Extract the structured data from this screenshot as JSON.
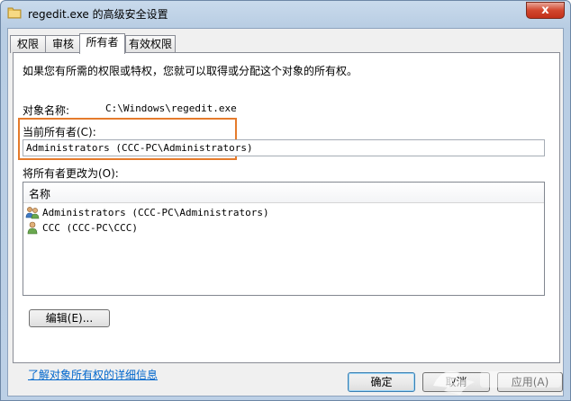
{
  "window": {
    "title": "regedit.exe 的高级安全设置",
    "close_glyph": "x"
  },
  "tabs": [
    {
      "label": "权限"
    },
    {
      "label": "审核"
    },
    {
      "label": "所有者"
    },
    {
      "label": "有效权限"
    }
  ],
  "active_tab": "所有者",
  "owner_page": {
    "intro": "如果您有所需的权限或特权，您就可以取得或分配这个对象的所有权。",
    "object_name_label": "对象名称:",
    "object_name_value": "C:\\Windows\\regedit.exe",
    "current_owner_label": "当前所有者(C):",
    "current_owner_value": "Administrators (CCC-PC\\Administrators)",
    "change_owner_label": "将所有者更改为(O):",
    "list_header": "名称",
    "owners": [
      {
        "name": "Administrators (CCC-PC\\Administrators)",
        "icon": "user-group-icon"
      },
      {
        "name": "CCC (CCC-PC\\CCC)",
        "icon": "user-icon"
      }
    ],
    "edit_button": "编辑(E)...",
    "learn_more_link": "了解对象所有权的详细信息"
  },
  "footer": {
    "ok": "确定",
    "cancel": "取消",
    "apply": "应用(A)"
  },
  "colors": {
    "highlight": "#e57b2c",
    "link": "#0066cc"
  }
}
